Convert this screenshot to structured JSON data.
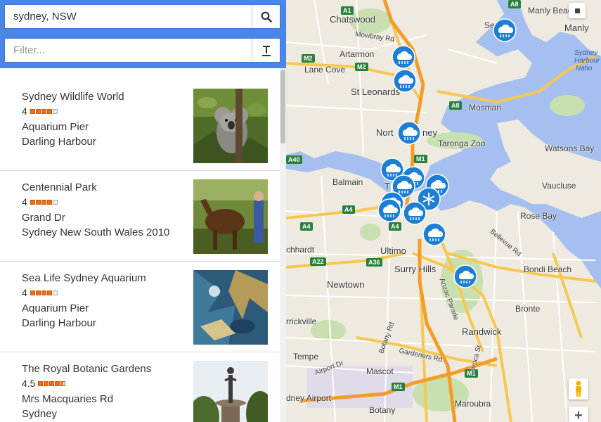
{
  "search": {
    "value": "sydney, NSW",
    "button_icon": "search-icon"
  },
  "filter": {
    "placeholder": "Filter...",
    "button_icon": "text-format-icon"
  },
  "results": [
    {
      "name": "Sydney Wildlife World",
      "rating": "4",
      "stars": 4,
      "line1": "Aquarium Pier",
      "line2": "Darling Harbour",
      "image": "koala"
    },
    {
      "name": "Centennial Park",
      "rating": "4",
      "stars": 4,
      "line1": "Grand Dr",
      "line2": "Sydney New South Wales 2010",
      "image": "horse"
    },
    {
      "name": "Sea Life Sydney Aquarium",
      "rating": "4",
      "stars": 4,
      "line1": "Aquarium Pier",
      "line2": "Darling Harbour",
      "image": "aquarium"
    },
    {
      "name": "The Royal Botanic Gardens",
      "rating": "4.5",
      "stars": 4.5,
      "line1": "Mrs Macquaries Rd",
      "line2": "Sydney",
      "image": "garden"
    }
  ],
  "map": {
    "places": [
      "Chatswood",
      "Artarmon",
      "Lane Cove",
      "St Leonards",
      "Mosman",
      "North Sydney",
      "Taronga Zoo",
      "Watsons Bay",
      "Balmain",
      "Vaucluse",
      "Rose Bay",
      "Ultimo",
      "Surry Hills",
      "Bondi Beach",
      "Newtown",
      "Bronte",
      "Randwick",
      "Tempe",
      "Mascot",
      "Sydney Airport",
      "Botany",
      "Maroubra",
      "Manly Beach",
      "Manly",
      "Seaforth",
      "Richardt",
      "Marrickville",
      "Sydney Harbour National"
    ],
    "partial_labels": {
      "richardt": "chhardt",
      "marrickville": "rrickville",
      "seaforth": "Se",
      "airport": "dney Airport",
      "sydney_cbd": "T",
      "north_sydney": "Nort",
      "sydney_ney": "ney",
      "harbour1": "Sydney",
      "harbour2": "Harbour",
      "harbour3": "Natio"
    },
    "roads": [
      "Mowbray Rd",
      "Bellevue Rd",
      "Anzac Parade",
      "Botany Rd",
      "Gardeners Rd",
      "Avoca St",
      "Airport Dr"
    ],
    "shields": [
      "A1",
      "A8",
      "M2",
      "M2",
      "A8",
      "M1",
      "A40",
      "A4",
      "A4",
      "A4",
      "A22",
      "A36",
      "M1",
      "M1"
    ],
    "controls": {
      "pegman": "pegman-icon",
      "zoom_in": "+"
    }
  }
}
